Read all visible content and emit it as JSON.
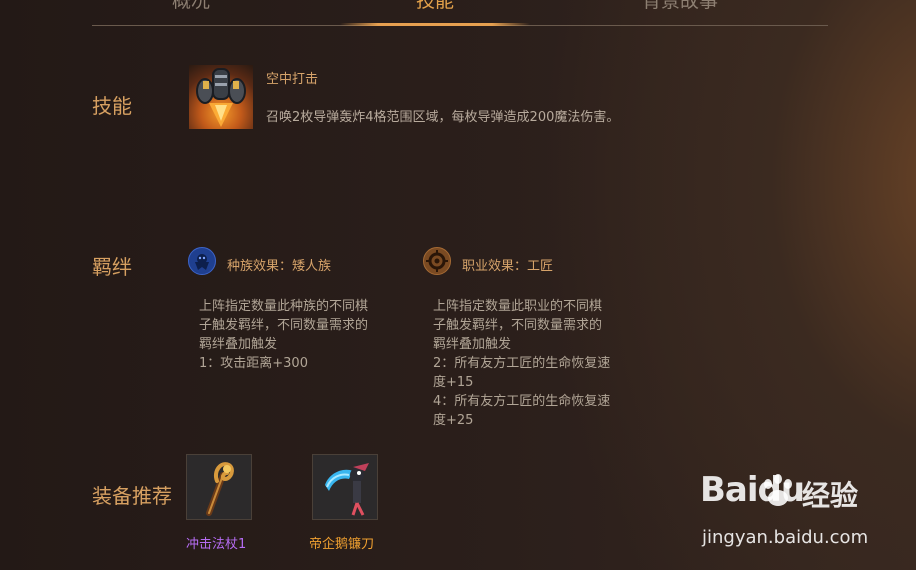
{
  "tabs": [
    {
      "label": "概况"
    },
    {
      "label": "技能"
    },
    {
      "label": "背景故事"
    }
  ],
  "sections": {
    "skill_title": "技能",
    "bond_title": "羁绊",
    "equip_title": "装备推荐"
  },
  "skill": {
    "name": "空中打击",
    "description": "召唤2枚导弹轰炸4格范围区域，每枚导弹造成200魔法伤害。"
  },
  "bonds": [
    {
      "label": "种族效果：矮人族",
      "icon": "dwarf-race-icon",
      "lines": [
        "上阵指定数量此种族的不同棋",
        "子触发羁绊，不同数量需求的",
        "羁绊叠加触发",
        "1：攻击距离+300"
      ]
    },
    {
      "label": "职业效果：工匠",
      "icon": "tinker-class-icon",
      "lines": [
        "上阵指定数量此职业的不同棋",
        "子触发羁绊，不同数量需求的",
        "羁绊叠加触发",
        "2：所有友方工匠的生命恢复速",
        "度+15",
        "4：所有友方工匠的生命恢复速",
        "度+25"
      ]
    }
  ],
  "equipment": [
    {
      "name": "冲击法杖1",
      "color": "#b56cf2",
      "icon": "staff-icon"
    },
    {
      "name": "帝企鹅镰刀",
      "color": "#f0a030",
      "icon": "scythe-icon"
    }
  ],
  "watermark": {
    "brand": "Baidu",
    "jing": "经验",
    "url": "jingyan.baidu.com"
  },
  "colors": {
    "accent": "#e3a14a",
    "section_title": "#d7a061",
    "text": "#b8ab9d"
  }
}
